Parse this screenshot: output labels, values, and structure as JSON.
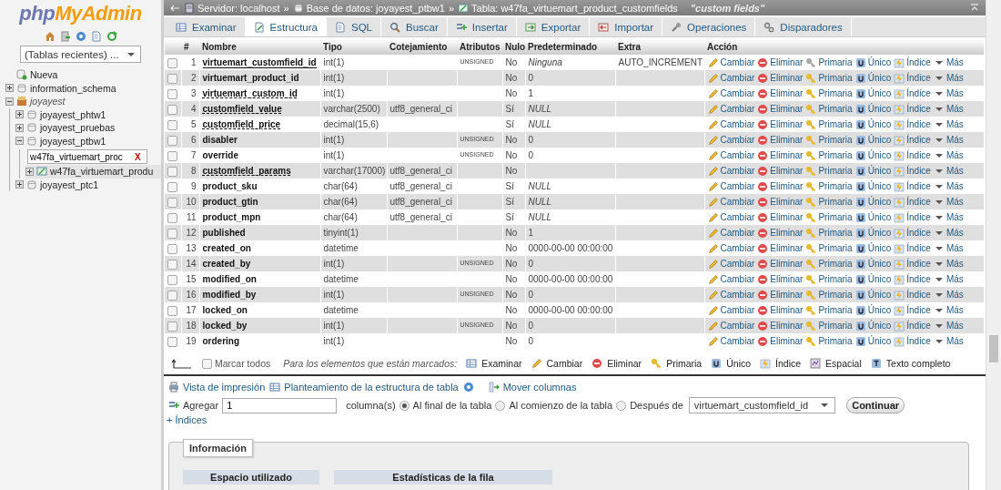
{
  "sidebar": {
    "logo": {
      "part_1": "php",
      "part_2": "MyAdmin"
    },
    "recent_tables": {
      "value": "(Tablas recientes) ..."
    },
    "tree": [
      {
        "label": "Nueva",
        "kind": "new"
      },
      {
        "label": "information_schema",
        "kind": "database",
        "expanded": false
      },
      {
        "label": "joyayest",
        "kind": "group",
        "expanded": true,
        "children": [
          {
            "label": "joyayest_phtw1",
            "kind": "database",
            "expanded": false
          },
          {
            "label": "joyayest_pruebas",
            "kind": "database",
            "expanded": false
          },
          {
            "label": "joyayest_ptbw1",
            "kind": "database",
            "expanded": true,
            "filter": {
              "value": "w47fa_virtuemart_proc",
              "clear": "X"
            },
            "children": [
              {
                "label": "w47fa_virtuemart_produ",
                "kind": "table",
                "selected": true,
                "expanded": false
              }
            ]
          },
          {
            "label": "joyayest_ptc1",
            "kind": "database",
            "expanded": false
          }
        ]
      }
    ]
  },
  "breadcrumb": {
    "items": [
      {
        "label": "Servidor: localhost",
        "kind": "server",
        "separator": "»"
      },
      {
        "label": "Base de datos: joyayest_ptbw1",
        "kind": "database",
        "separator": "»"
      },
      {
        "label": "Tabla: w47fa_virtuemart_product_customfields",
        "kind": "table"
      }
    ],
    "comment": "\"custom fields\""
  },
  "tabs": [
    {
      "label": "Examinar",
      "selected": false
    },
    {
      "label": "Estructura",
      "selected": true
    },
    {
      "label": "SQL",
      "selected": false
    },
    {
      "label": "Buscar",
      "selected": false
    },
    {
      "label": "Insertar",
      "selected": false
    },
    {
      "label": "Exportar",
      "selected": false
    },
    {
      "label": "Importar",
      "selected": false
    },
    {
      "label": "Operaciones",
      "selected": false
    },
    {
      "label": "Disparadores",
      "selected": false
    }
  ],
  "table": {
    "columns": [
      "#",
      "Nombre",
      "Tipo",
      "Cotejamiento",
      "Atributos",
      "Nulo",
      "Predeterminado",
      "Extra",
      "Acción"
    ],
    "rows": [
      {
        "checked": false,
        "number": "1",
        "name": "virtuemart_customfield_id",
        "primary": true,
        "commented": false,
        "type": "int(1)",
        "attributes": "UNSIGNED",
        "null": "No",
        "default": "Ninguna",
        "default_italic": true,
        "extra": "AUTO_INCREMENT",
        "actions": [
          "Cambiar",
          "Eliminar",
          "Primaria",
          "Único",
          "Índice",
          "Más"
        ]
      },
      {
        "checked": false,
        "number": "2",
        "name": "virtuemart_product_id",
        "primary": false,
        "commented": false,
        "type": "int(1)",
        "null": "No",
        "default": "0",
        "default_italic": false,
        "actions": [
          "Cambiar",
          "Eliminar",
          "Primaria",
          "Único",
          "Índice",
          "Más"
        ]
      },
      {
        "checked": false,
        "number": "3",
        "name": "virtuemart_custom_id",
        "primary": false,
        "commented": true,
        "type": "int(1)",
        "null": "No",
        "default": "1",
        "default_italic": false,
        "actions": [
          "Cambiar",
          "Eliminar",
          "Primaria",
          "Único",
          "Índice",
          "Más"
        ]
      },
      {
        "checked": false,
        "number": "4",
        "name": "customfield_value",
        "primary": false,
        "commented": true,
        "type": "varchar(2500)",
        "collation": "utf8_general_ci",
        "null": "Sí",
        "default": "NULL",
        "default_italic": true,
        "actions": [
          "Cambiar",
          "Eliminar",
          "Primaria",
          "Único",
          "Índice",
          "Más"
        ]
      },
      {
        "checked": false,
        "number": "5",
        "name": "customfield_price",
        "primary": false,
        "commented": true,
        "type": "decimal(15,6)",
        "null": "Sí",
        "default": "NULL",
        "default_italic": true,
        "actions": [
          "Cambiar",
          "Eliminar",
          "Primaria",
          "Único",
          "Índice",
          "Más"
        ]
      },
      {
        "checked": false,
        "number": "6",
        "name": "disabler",
        "primary": false,
        "commented": false,
        "type": "int(1)",
        "attributes": "UNSIGNED",
        "null": "No",
        "default": "0",
        "default_italic": false,
        "actions": [
          "Cambiar",
          "Eliminar",
          "Primaria",
          "Único",
          "Índice",
          "Más"
        ]
      },
      {
        "checked": false,
        "number": "7",
        "name": "override",
        "primary": false,
        "commented": false,
        "type": "int(1)",
        "attributes": "UNSIGNED",
        "null": "No",
        "default": "0",
        "default_italic": false,
        "actions": [
          "Cambiar",
          "Eliminar",
          "Primaria",
          "Único",
          "Índice",
          "Más"
        ]
      },
      {
        "checked": false,
        "number": "8",
        "name": "customfield_params",
        "primary": false,
        "commented": true,
        "type": "varchar(17000)",
        "collation": "utf8_general_ci",
        "null": "No",
        "actions": [
          "Cambiar",
          "Eliminar",
          "Primaria",
          "Único",
          "Índice",
          "Más"
        ]
      },
      {
        "checked": false,
        "number": "9",
        "name": "product_sku",
        "primary": false,
        "commented": false,
        "type": "char(64)",
        "collation": "utf8_general_ci",
        "null": "Sí",
        "default": "NULL",
        "default_italic": true,
        "actions": [
          "Cambiar",
          "Eliminar",
          "Primaria",
          "Único",
          "Índice",
          "Más"
        ]
      },
      {
        "checked": false,
        "number": "10",
        "name": "product_gtin",
        "primary": false,
        "commented": false,
        "type": "char(64)",
        "collation": "utf8_general_ci",
        "null": "Sí",
        "default": "NULL",
        "default_italic": true,
        "actions": [
          "Cambiar",
          "Eliminar",
          "Primaria",
          "Único",
          "Índice",
          "Más"
        ]
      },
      {
        "checked": false,
        "number": "11",
        "name": "product_mpn",
        "primary": false,
        "commented": false,
        "type": "char(64)",
        "collation": "utf8_general_ci",
        "null": "Sí",
        "default": "NULL",
        "default_italic": true,
        "actions": [
          "Cambiar",
          "Eliminar",
          "Primaria",
          "Único",
          "Índice",
          "Más"
        ]
      },
      {
        "checked": false,
        "number": "12",
        "name": "published",
        "primary": false,
        "commented": false,
        "type": "tinyint(1)",
        "null": "No",
        "default": "1",
        "default_italic": false,
        "actions": [
          "Cambiar",
          "Eliminar",
          "Primaria",
          "Único",
          "Índice",
          "Más"
        ]
      },
      {
        "checked": false,
        "number": "13",
        "name": "created_on",
        "primary": false,
        "commented": false,
        "type": "datetime",
        "null": "No",
        "default": "0000-00-00 00:00:00",
        "default_italic": false,
        "actions": [
          "Cambiar",
          "Eliminar",
          "Primaria",
          "Único",
          "Índice",
          "Más"
        ]
      },
      {
        "checked": false,
        "number": "14",
        "name": "created_by",
        "primary": false,
        "commented": false,
        "type": "int(1)",
        "attributes": "UNSIGNED",
        "null": "No",
        "default": "0",
        "default_italic": false,
        "actions": [
          "Cambiar",
          "Eliminar",
          "Primaria",
          "Único",
          "Índice",
          "Más"
        ]
      },
      {
        "checked": false,
        "number": "15",
        "name": "modified_on",
        "primary": false,
        "commented": false,
        "type": "datetime",
        "null": "No",
        "default": "0000-00-00 00:00:00",
        "default_italic": false,
        "actions": [
          "Cambiar",
          "Eliminar",
          "Primaria",
          "Único",
          "Índice",
          "Más"
        ]
      },
      {
        "checked": false,
        "number": "16",
        "name": "modified_by",
        "primary": false,
        "commented": false,
        "type": "int(1)",
        "attributes": "UNSIGNED",
        "null": "No",
        "default": "0",
        "default_italic": false,
        "actions": [
          "Cambiar",
          "Eliminar",
          "Primaria",
          "Único",
          "Índice",
          "Más"
        ]
      },
      {
        "checked": false,
        "number": "17",
        "name": "locked_on",
        "primary": false,
        "commented": false,
        "type": "datetime",
        "null": "No",
        "default": "0000-00-00 00:00:00",
        "default_italic": false,
        "actions": [
          "Cambiar",
          "Eliminar",
          "Primaria",
          "Único",
          "Índice",
          "Más"
        ]
      },
      {
        "checked": false,
        "number": "18",
        "name": "locked_by",
        "primary": false,
        "commented": false,
        "type": "int(1)",
        "attributes": "UNSIGNED",
        "null": "No",
        "default": "0",
        "default_italic": false,
        "actions": [
          "Cambiar",
          "Eliminar",
          "Primaria",
          "Único",
          "Índice",
          "Más"
        ]
      },
      {
        "checked": false,
        "number": "19",
        "name": "ordering",
        "primary": false,
        "commented": false,
        "type": "int(1)",
        "null": "No",
        "default": "0",
        "default_italic": false,
        "actions": [
          "Cambiar",
          "Eliminar",
          "Primaria",
          "Único",
          "Índice",
          "Más"
        ]
      }
    ]
  },
  "bulk": {
    "check_all": {
      "label": "Marcar todos",
      "checked": false
    },
    "prompt": "Para los elementos que están marcados:",
    "actions": [
      "Examinar",
      "Cambiar",
      "Eliminar",
      "Primaria",
      "Único",
      "Índice",
      "Espacial",
      "Texto completo"
    ]
  },
  "links": [
    "Vista de impresión",
    "Planteamiento de la estructura de tabla",
    "Mover columnas"
  ],
  "add_columns": {
    "label": "Agregar",
    "count": "1",
    "unit": "columna(s)",
    "positions": [
      {
        "label": "Al final de la tabla",
        "selected": true
      },
      {
        "label": "Al comienzo de la tabla",
        "selected": false
      },
      {
        "label": "Después de",
        "selected": false
      }
    ],
    "after_column": "virtuemart_customfield_id",
    "submit": "Continuar"
  },
  "indexes_link": "+ Índices",
  "info": {
    "legend": "Información",
    "headers": [
      "Espacio utilizado",
      "Estadísticas de la fila"
    ]
  }
}
